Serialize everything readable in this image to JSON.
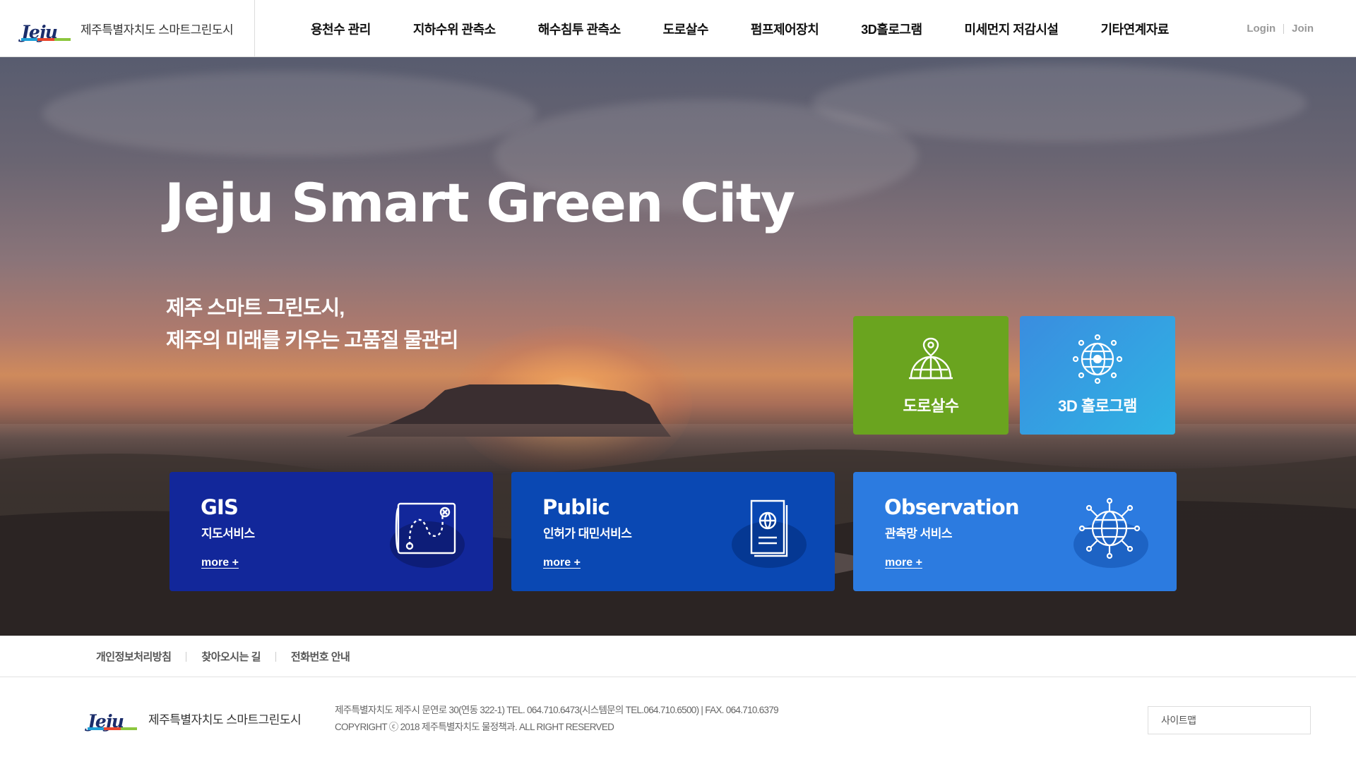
{
  "header": {
    "logo_word": "Jeju",
    "logo_text": "제주특별자치도 스마트그린도시",
    "nav": [
      "용천수 관리",
      "지하수위 관측소",
      "해수침투 관측소",
      "도로살수",
      "펌프제어장치",
      "3D홀로그램",
      "미세먼지 저감시설",
      "기타연계자료"
    ],
    "login": "Login",
    "join": "Join"
  },
  "hero": {
    "title": "Jeju Smart Green City",
    "subtitle_line1": "제주 스마트 그린도시,",
    "subtitle_line2": "제주의 미래를 키우는 고품질 물관리",
    "quick_links": [
      {
        "label": "도로살수",
        "icon": "globe-pin-icon",
        "color": "#6aa41f"
      },
      {
        "label": "3D 홀로그램",
        "icon": "network-globe-icon",
        "color": "#2fa1e3"
      }
    ],
    "cards": [
      {
        "title": "GIS",
        "subtitle": "지도서비스",
        "more": "more +",
        "icon": "map-route-icon",
        "color": "#12279a"
      },
      {
        "title": "Public",
        "subtitle": "인허가 대민서비스",
        "more": "more +",
        "icon": "passport-icon",
        "color": "#0a48b3"
      },
      {
        "title": "Observation",
        "subtitle": "관측망 서비스",
        "more": "more +",
        "icon": "globe-network-icon",
        "color": "#2c7be0"
      }
    ]
  },
  "footer": {
    "links": [
      "개인정보처리방침",
      "찾아오시는 길",
      "전화번호 안내"
    ],
    "logo_word": "Jeju",
    "logo_text": "제주특별자치도 스마트그린도시",
    "address": "제주특별자치도 제주시 문연로 30(연동 322-1) TEL. 064.710.6473(시스템문의 TEL.064.710.6500) | FAX. 064.710.6379",
    "copyright": "COPYRIGHT ⓒ 2018 제주특별자치도 물정책과. ALL RIGHT RESERVED",
    "sitemap": "사이트맵"
  }
}
